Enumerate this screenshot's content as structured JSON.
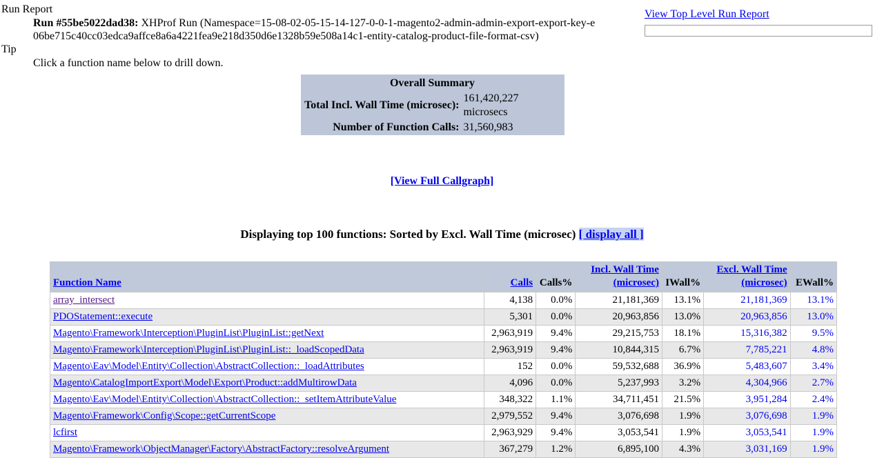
{
  "report": {
    "run_report_label": "Run Report",
    "run_label": "Run #55be5022dad38:",
    "run_description": " XHProf Run (Namespace=15-08-02-05-15-14-127-0-0-1-magento2-admin-admin-export-export-key-e06be715c40cc03edca9affce8a6a4221fea9e218d350d6e1328b59e508a14c1-entity-catalog-product-file-format-csv)",
    "tip_label": "Tip",
    "tip_text": "Click a function name below to drill down."
  },
  "top_right": {
    "view_top_level_link": "View Top Level Run Report",
    "run_input_value": "",
    "run_input_placeholder": ""
  },
  "summary": {
    "title": "Overall Summary",
    "rows": [
      {
        "label": "Total Incl. Wall Time (microsec):",
        "value": "161,420,227 microsecs"
      },
      {
        "label": "Number of Function Calls:",
        "value": "31,560,983"
      }
    ],
    "total_incl_wall_time_label": "Total Incl. Wall Time (microsec):",
    "total_incl_wall_time_value": "161,420,227 microsecs",
    "num_calls_label": "Number of Function Calls:",
    "num_calls_value": "31,560,983",
    "background_color": "#bcc6d8"
  },
  "callgraph": {
    "link_text": "[View Full Callgraph]"
  },
  "heading": {
    "text": "Displaying top 100 functions: Sorted by Excl. Wall Time (microsec)",
    "display_all_link": "[ display all ]",
    "highlight_color": "#c6d4f2"
  },
  "table": {
    "headers": {
      "function_name": "Function Name",
      "calls": "Calls",
      "calls_pct": "Calls%",
      "incl_wall_line1": "Incl. Wall Time",
      "incl_wall_line2": "(microsec)",
      "iwall_pct": "IWall%",
      "excl_wall_line1": "Excl. Wall Time",
      "excl_wall_line2": "(microsec)",
      "ewall_pct": "EWall%"
    },
    "header_background": "#bfc9d9",
    "link_color": "#0000ee",
    "visited_link_color": "#551a8b",
    "rows": [
      {
        "function": "array_intersect",
        "visited": true,
        "calls": "4,138",
        "calls_pct": "0.0%",
        "incl_wall": "21,181,369",
        "iwall_pct": "13.1%",
        "excl_wall": "21,181,369",
        "ewall_pct": "13.1%"
      },
      {
        "function": "PDOStatement::execute",
        "visited": false,
        "calls": "5,301",
        "calls_pct": "0.0%",
        "incl_wall": "20,963,856",
        "iwall_pct": "13.0%",
        "excl_wall": "20,963,856",
        "ewall_pct": "13.0%"
      },
      {
        "function": "Magento\\Framework\\Interception\\PluginList\\PluginList::getNext",
        "visited": false,
        "calls": "2,963,919",
        "calls_pct": "9.4%",
        "incl_wall": "29,215,753",
        "iwall_pct": "18.1%",
        "excl_wall": "15,316,382",
        "ewall_pct": "9.5%"
      },
      {
        "function": "Magento\\Framework\\Interception\\PluginList\\PluginList::_loadScopedData",
        "visited": false,
        "calls": "2,963,919",
        "calls_pct": "9.4%",
        "incl_wall": "10,844,315",
        "iwall_pct": "6.7%",
        "excl_wall": "7,785,221",
        "ewall_pct": "4.8%"
      },
      {
        "function": "Magento\\Eav\\Model\\Entity\\Collection\\AbstractCollection::_loadAttributes",
        "visited": false,
        "calls": "152",
        "calls_pct": "0.0%",
        "incl_wall": "59,532,688",
        "iwall_pct": "36.9%",
        "excl_wall": "5,483,607",
        "ewall_pct": "3.4%"
      },
      {
        "function": "Magento\\CatalogImportExport\\Model\\Export\\Product::addMultirowData",
        "visited": false,
        "calls": "4,096",
        "calls_pct": "0.0%",
        "incl_wall": "5,237,993",
        "iwall_pct": "3.2%",
        "excl_wall": "4,304,966",
        "ewall_pct": "2.7%"
      },
      {
        "function": "Magento\\Eav\\Model\\Entity\\Collection\\AbstractCollection::_setItemAttributeValue",
        "visited": false,
        "calls": "348,322",
        "calls_pct": "1.1%",
        "incl_wall": "34,711,451",
        "iwall_pct": "21.5%",
        "excl_wall": "3,951,284",
        "ewall_pct": "2.4%"
      },
      {
        "function": "Magento\\Framework\\Config\\Scope::getCurrentScope",
        "visited": false,
        "calls": "2,979,552",
        "calls_pct": "9.4%",
        "incl_wall": "3,076,698",
        "iwall_pct": "1.9%",
        "excl_wall": "3,076,698",
        "ewall_pct": "1.9%"
      },
      {
        "function": "lcfirst",
        "visited": false,
        "calls": "2,963,929",
        "calls_pct": "9.4%",
        "incl_wall": "3,053,541",
        "iwall_pct": "1.9%",
        "excl_wall": "3,053,541",
        "ewall_pct": "1.9%"
      },
      {
        "function": "Magento\\Framework\\ObjectManager\\Factory\\AbstractFactory::resolveArgument",
        "visited": false,
        "calls": "367,279",
        "calls_pct": "1.2%",
        "incl_wall": "6,895,100",
        "iwall_pct": "4.3%",
        "excl_wall": "3,031,169",
        "ewall_pct": "1.9%"
      }
    ]
  }
}
